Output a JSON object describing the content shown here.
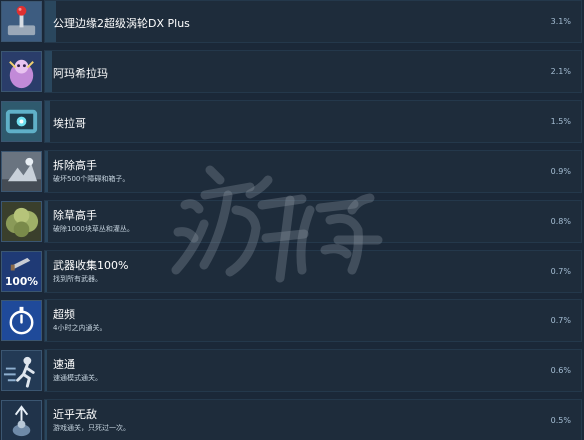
{
  "achievements": [
    {
      "title": "公理边缘2超级涡轮DX Plus",
      "desc": "",
      "percent": "3.1%",
      "fill": 0.031,
      "icon": "arcade-joystick-icon"
    },
    {
      "title": "阿玛希拉玛",
      "desc": "",
      "percent": "2.1%",
      "fill": 0.021,
      "icon": "boss-creature-icon"
    },
    {
      "title": "埃拉哥",
      "desc": "",
      "percent": "1.5%",
      "fill": 0.015,
      "icon": "machine-boss-icon"
    },
    {
      "title": "拆除高手",
      "desc": "破坏500个障碍和箱子。",
      "percent": "0.9%",
      "fill": 0.009,
      "icon": "demolition-icon"
    },
    {
      "title": "除草高手",
      "desc": "破除1000块草丛和灌丛。",
      "percent": "0.8%",
      "fill": 0.008,
      "icon": "bush-icon"
    },
    {
      "title": "武器收集100%",
      "desc": "找到所有武器。",
      "percent": "0.7%",
      "fill": 0.007,
      "icon": "weapon-100-icon"
    },
    {
      "title": "超频",
      "desc": "4小时之内通关。",
      "percent": "0.7%",
      "fill": 0.007,
      "icon": "stopwatch-icon"
    },
    {
      "title": "速通",
      "desc": "速通模式通关。",
      "percent": "0.6%",
      "fill": 0.006,
      "icon": "speedrunner-icon"
    },
    {
      "title": "近乎无敌",
      "desc": "游戏通关，只死过一次。",
      "percent": "0.5%",
      "fill": 0.005,
      "icon": "ghost-ascend-icon"
    }
  ],
  "watermark": {
    "text": "游侠网"
  },
  "colors": {
    "background": "#1b2838",
    "row": "#1e2c3b",
    "progress_fill": "#2a475e",
    "percent_text": "#a5bed4"
  }
}
